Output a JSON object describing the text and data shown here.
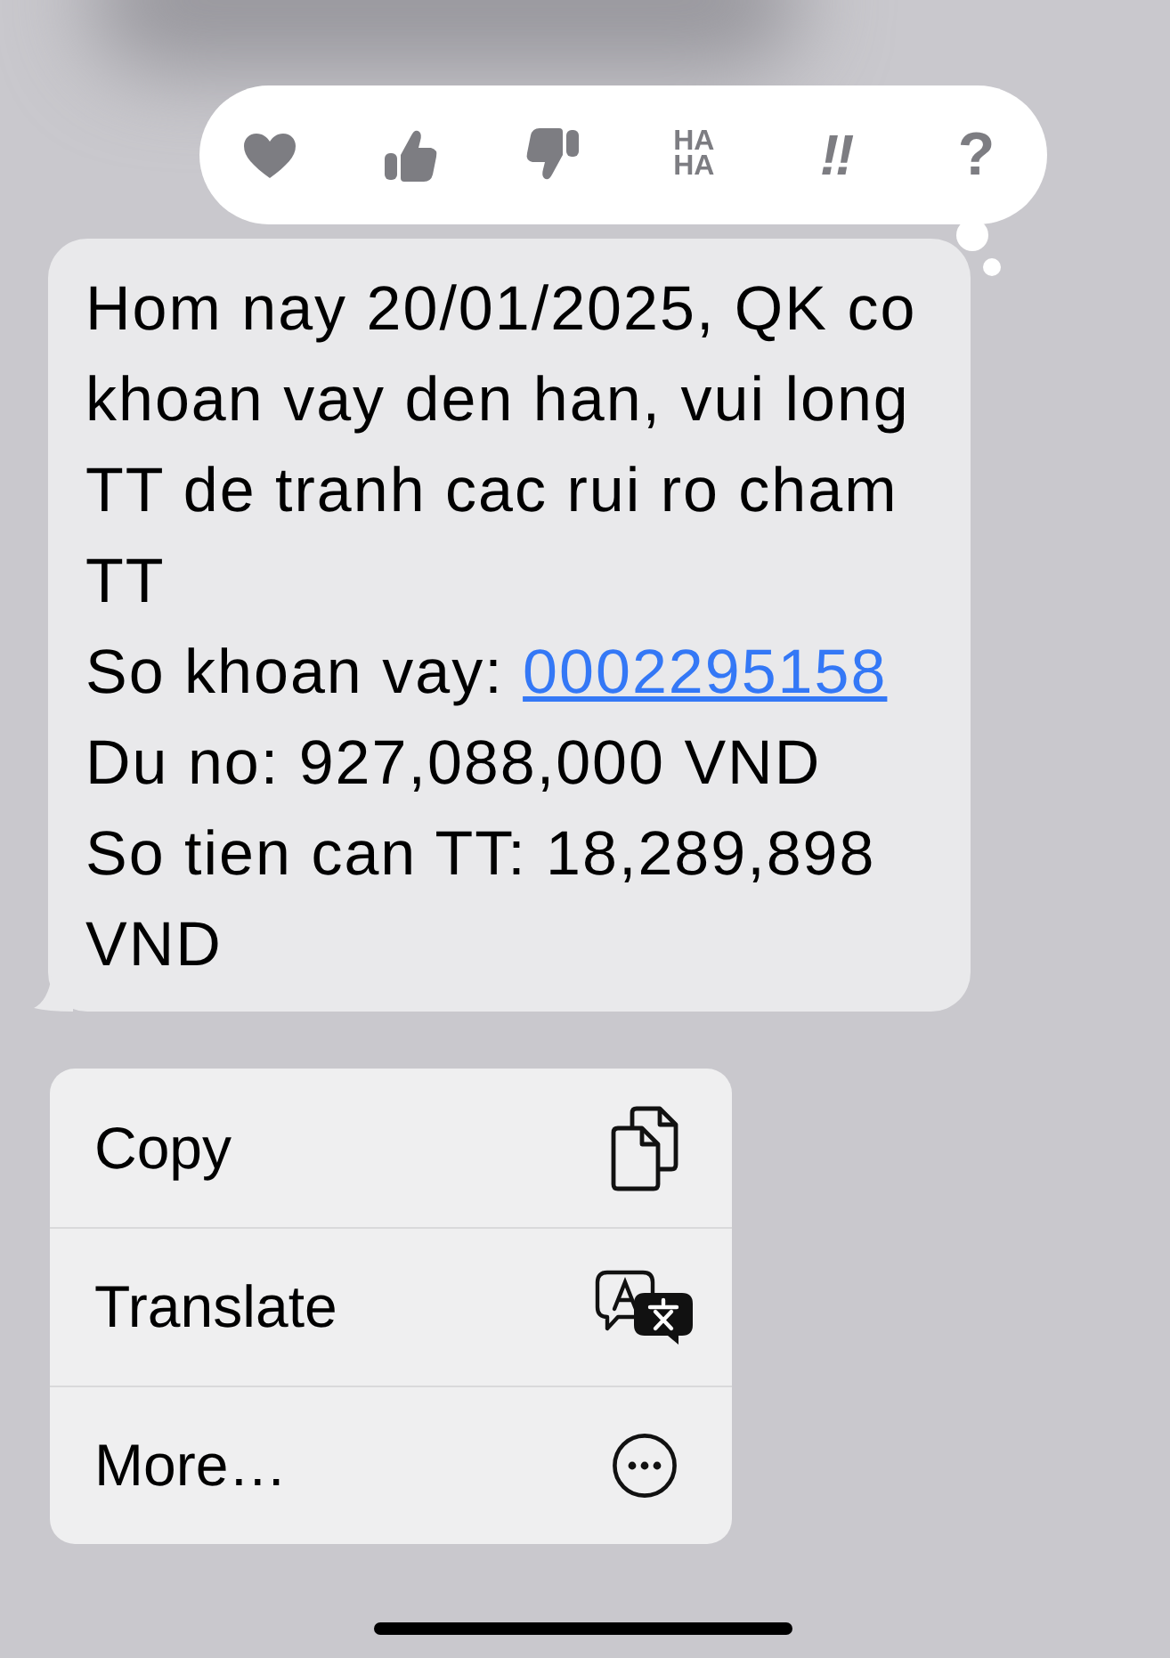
{
  "reactions": [
    {
      "kind": "heart"
    },
    {
      "kind": "thumbs_up"
    },
    {
      "kind": "thumbs_down"
    },
    {
      "kind": "glyph",
      "lines": [
        "HA",
        "HA"
      ]
    },
    {
      "kind": "glyph",
      "lines": [
        "!!"
      ]
    },
    {
      "kind": "glyph",
      "lines": [
        "?"
      ]
    }
  ],
  "message": {
    "paragraphs": [
      {
        "text": "Hom nay 20/01/2025, QK co khoan vay den han, vui long TT de tranh cac rui ro cham TT"
      },
      {
        "text": "So khoan vay: ",
        "link": "0002295158"
      },
      {
        "text": "Du no: 927,088,000 VND"
      },
      {
        "text": "So tien can TT: 18,289,898 VND"
      }
    ]
  },
  "menu": {
    "items": [
      {
        "label": "Copy",
        "kind": "copy"
      },
      {
        "label": "Translate",
        "kind": "translate"
      },
      {
        "label": "More…",
        "kind": "more"
      }
    ]
  }
}
